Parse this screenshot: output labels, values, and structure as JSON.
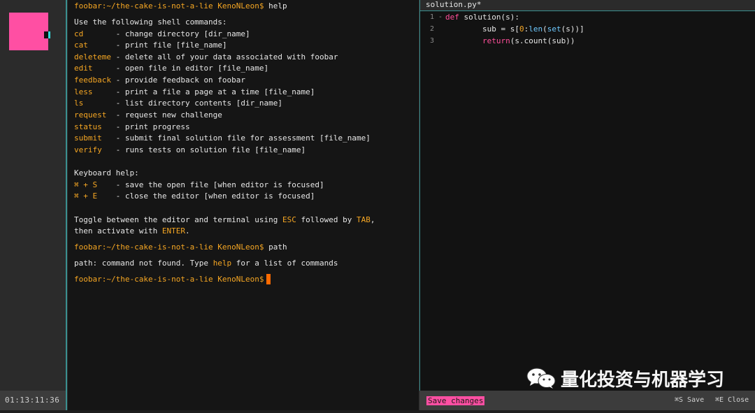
{
  "sidebar": {
    "timer": "01:13:11:36"
  },
  "terminal": {
    "prompt": "foobar:~/the-cake-is-not-a-lie KenoNLeon$",
    "cmd1": " help",
    "intro": "Use the following shell commands:",
    "commands": [
      {
        "name": "cd",
        "pad": "       ",
        "desc": "- change directory [dir_name]"
      },
      {
        "name": "cat",
        "pad": "      ",
        "desc": "- print file [file_name]"
      },
      {
        "name": "deleteme",
        "pad": " ",
        "desc": "- delete all of your data associated with foobar"
      },
      {
        "name": "edit",
        "pad": "     ",
        "desc": "- open file in editor [file_name]"
      },
      {
        "name": "feedback",
        "pad": " ",
        "desc": "- provide feedback on foobar"
      },
      {
        "name": "less",
        "pad": "     ",
        "desc": "- print a file a page at a time [file_name]"
      },
      {
        "name": "ls",
        "pad": "       ",
        "desc": "- list directory contents [dir_name]"
      },
      {
        "name": "request",
        "pad": "  ",
        "desc": "- request new challenge"
      },
      {
        "name": "status",
        "pad": "   ",
        "desc": "- print progress"
      },
      {
        "name": "submit",
        "pad": "   ",
        "desc": "- submit final solution file for assessment [file_name]"
      },
      {
        "name": "verify",
        "pad": "   ",
        "desc": "- runs tests on solution file [file_name]"
      }
    ],
    "keyboard_help": "Keyboard help:",
    "shortcuts": [
      {
        "key": "⌘ + S",
        "pad": "    ",
        "desc": "- save the open file [when editor is focused]"
      },
      {
        "key": "⌘ + E",
        "pad": "    ",
        "desc": "- close the editor [when editor is focused]"
      }
    ],
    "toggle_a": "Toggle between the editor and terminal using ",
    "toggle_esc": "ESC",
    "toggle_b": " followed by ",
    "toggle_tab": "TAB",
    "toggle_c": ",",
    "toggle_d": "then activate with ",
    "toggle_enter": "ENTER",
    "toggle_e": ".",
    "cmd2": " path",
    "err_a": "path: command not found. Type ",
    "err_help": "help",
    "err_b": " for a list of commands"
  },
  "editor": {
    "tab_label": "solution.py*",
    "lines": [
      {
        "num": "1 -",
        "text": ""
      },
      {
        "num": "2",
        "text": ""
      },
      {
        "num": "3",
        "text": ""
      }
    ],
    "code": {
      "l1_kw": "def",
      "l1_rest": " solution(s):",
      "l2_a": "        sub = s[",
      "l2_num": "0",
      "l2_b": ":",
      "l2_fn1": "len",
      "l2_c": "(",
      "l2_fn2": "set",
      "l2_d": "(s))]",
      "l3_indent": "        ",
      "l3_kw": "return",
      "l3_rest": "(s.count(sub))"
    },
    "status": {
      "save_changes": "Save changes",
      "hint_save": "⌘S Save",
      "hint_close": "⌘E Close"
    }
  },
  "watermark": {
    "text": "量化投资与机器学习",
    "icon": "wechat-icon"
  },
  "colors": {
    "accent_pink": "#ff4fa3",
    "accent_orange": "#f5a623",
    "cursor": "#ff6a00",
    "teal_border": "#3a8f8f"
  }
}
